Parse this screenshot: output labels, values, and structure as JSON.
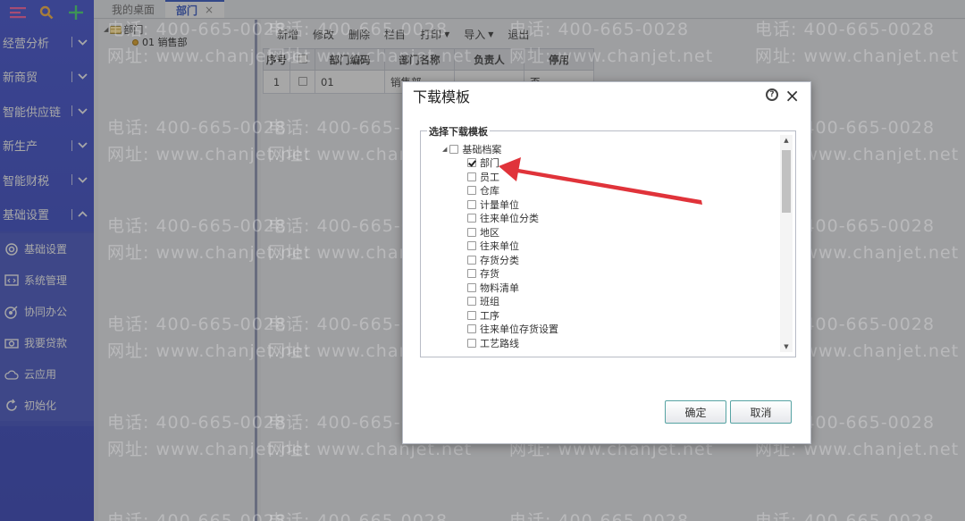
{
  "tabs": [
    {
      "label": "我的桌面",
      "active": false
    },
    {
      "label": "部门",
      "active": true,
      "close": "×"
    }
  ],
  "sidebar": {
    "categories": [
      {
        "label": "经营分析",
        "chev": "down"
      },
      {
        "label": "新商贸",
        "chev": "down"
      },
      {
        "label": "智能供应链",
        "chev": "down"
      },
      {
        "label": "新生产",
        "chev": "down"
      },
      {
        "label": "智能财税",
        "chev": "down"
      },
      {
        "label": "基础设置",
        "chev": "up"
      }
    ],
    "sub_items": [
      {
        "label": "基础设置",
        "icon": "gear-icon"
      },
      {
        "label": "系统管理",
        "icon": "code-window-icon"
      },
      {
        "label": "协同办公",
        "icon": "target-icon"
      },
      {
        "label": "我要贷款",
        "icon": "camera-icon"
      },
      {
        "label": "云应用",
        "icon": "cloud-icon"
      },
      {
        "label": "初始化",
        "icon": "refresh-icon"
      }
    ]
  },
  "tree": {
    "root_label": "部门",
    "child_label": "01 销售部"
  },
  "toolbar": {
    "new": "新增",
    "edit": "修改",
    "delete": "删除",
    "columns": "栏目",
    "print": "打印",
    "import": "导入",
    "exit": "退出"
  },
  "grid": {
    "headers": {
      "seq": "序号",
      "code": "部门编码",
      "name": "部门名称",
      "owner": "负责人",
      "disabled": "停用"
    },
    "row": {
      "seq": "1",
      "code": "01",
      "name": "销售部",
      "owner": "",
      "disabled": "否"
    }
  },
  "watermark": {
    "phone": "电话: 400-665-0028",
    "site": "网址: www.chanjet.net"
  },
  "modal": {
    "title": "下载模板",
    "help": "?",
    "close": "×",
    "legend": "选择下载模板",
    "root": "基础档案",
    "items": [
      "部门",
      "员工",
      "仓库",
      "计量单位",
      "往来单位分类",
      "地区",
      "往来单位",
      "存货分类",
      "存货",
      "物料清单",
      "班组",
      "工序",
      "往来单位存货设置",
      "工艺路线"
    ],
    "checked_item": "部门",
    "ok": "确定",
    "cancel": "取消"
  },
  "colors": {
    "sidebar": "#3344c8",
    "accent": "#2b50c6",
    "arrow": "#e0333a"
  }
}
